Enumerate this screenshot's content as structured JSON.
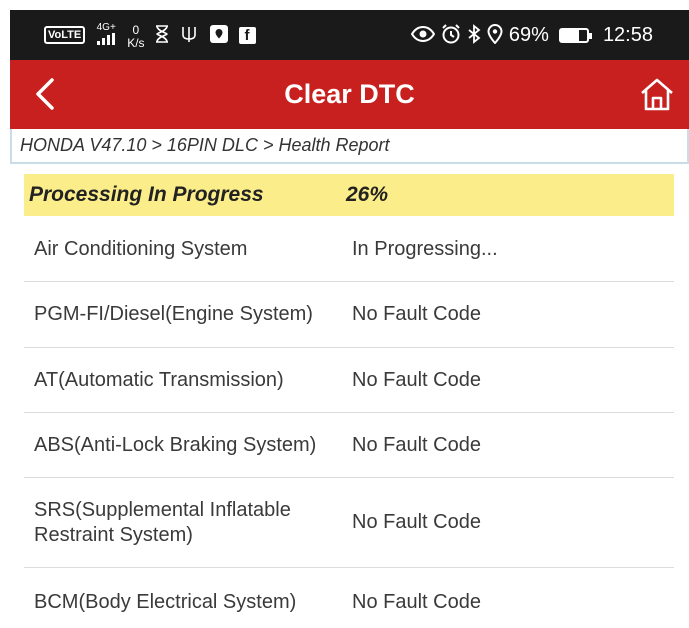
{
  "status_bar": {
    "volte": "VoLTE",
    "network_type": "4G+",
    "network_sub": "1l",
    "net_speed_value": "0",
    "net_speed_unit": "K/s",
    "battery_percent": "69%",
    "battery_level": 0.69,
    "time": "12:58",
    "icons": [
      "hourglass-icon",
      "usb-icon",
      "location-icon",
      "facebook-icon",
      "eye-icon",
      "alarm-icon",
      "bluetooth-icon",
      "location-pin-icon",
      "battery-icon"
    ]
  },
  "header": {
    "title": "Clear DTC",
    "back_icon": "back-chevron-icon",
    "home_icon": "home-icon"
  },
  "breadcrumb": "HONDA V47.10 > 16PIN DLC > Health Report",
  "progress": {
    "label": "Processing In Progress",
    "value": "26%"
  },
  "systems": [
    {
      "name": "Air Conditioning System",
      "status": "In Progressing..."
    },
    {
      "name": "PGM-FI/Diesel(Engine System)",
      "status": "No Fault Code"
    },
    {
      "name": "AT(Automatic Transmission)",
      "status": "No Fault Code"
    },
    {
      "name": "ABS(Anti-Lock Braking System)",
      "status": "No Fault Code"
    },
    {
      "name": "SRS(Supplemental Inflatable Restraint System)",
      "status": "No Fault Code"
    },
    {
      "name": "BCM(Body Electrical System)",
      "status": "No Fault Code"
    }
  ],
  "colors": {
    "header_red": "#c8201e",
    "progress_yellow": "#fbee8a",
    "status_bar": "#1a1a1a"
  }
}
